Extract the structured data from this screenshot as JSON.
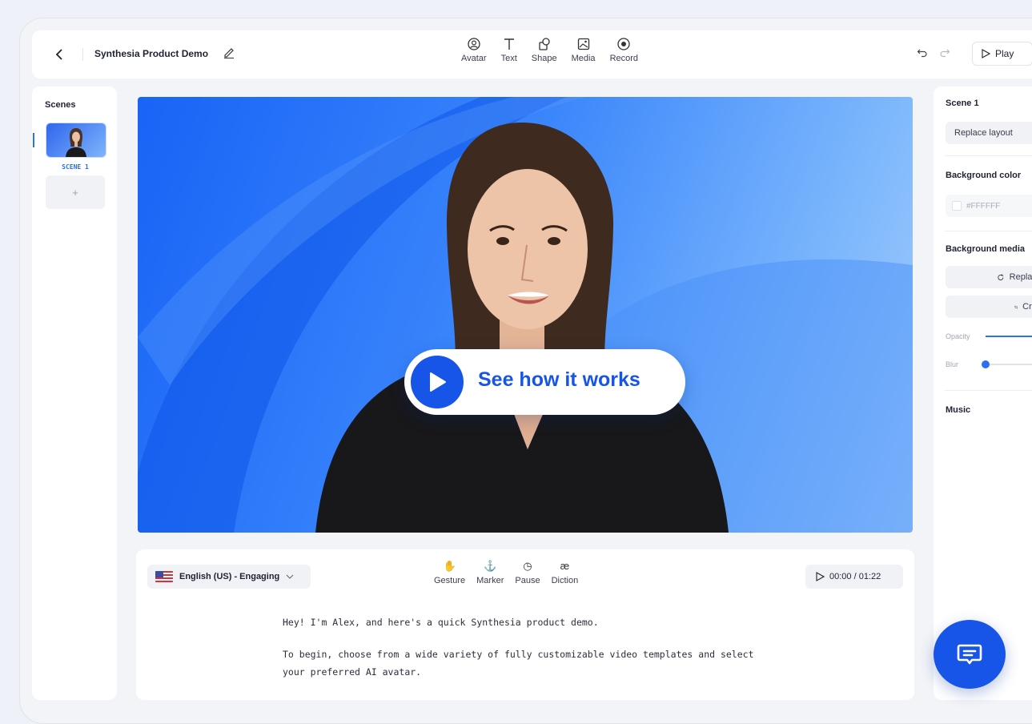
{
  "topbar": {
    "project_title": "Synthesia Product Demo",
    "tools": [
      {
        "label": "Avatar",
        "icon": "avatar-icon"
      },
      {
        "label": "Text",
        "icon": "text-icon"
      },
      {
        "label": "Shape",
        "icon": "shape-icon"
      },
      {
        "label": "Media",
        "icon": "media-icon"
      },
      {
        "label": "Record",
        "icon": "record-icon"
      }
    ],
    "play_label": "Play"
  },
  "scenes": {
    "title": "Scenes",
    "items": [
      {
        "label": "SCENE 1"
      }
    ],
    "add_label": "+"
  },
  "canvas": {
    "cta_label": "See how it works"
  },
  "script": {
    "language": "English (US) - Engaging",
    "tools": [
      {
        "label": "Gesture",
        "glyph": "✋"
      },
      {
        "label": "Marker",
        "glyph": "⚓"
      },
      {
        "label": "Pause",
        "glyph": "◷"
      },
      {
        "label": "Diction",
        "glyph": "æ"
      }
    ],
    "time": "00:00 / 01:22",
    "paragraphs": [
      "Hey! I'm Alex, and here's a quick Synthesia product demo.",
      "To begin, choose from a wide variety of fully customizable video templates and select your preferred AI avatar."
    ]
  },
  "properties": {
    "scene_title": "Scene 1",
    "replace_layout": "Replace layout",
    "background_color_title": "Background color",
    "background_color_value": "#FFFFFF",
    "background_media_title": "Background media",
    "replace_label": "Replace",
    "crop_label": "Crop",
    "opacity_label": "Opacity",
    "blur_label": "Blur",
    "music_title": "Music"
  },
  "colors": {
    "accent": "#1755e8",
    "canvas_start": "#1864f6",
    "canvas_end": "#a5cefd"
  }
}
